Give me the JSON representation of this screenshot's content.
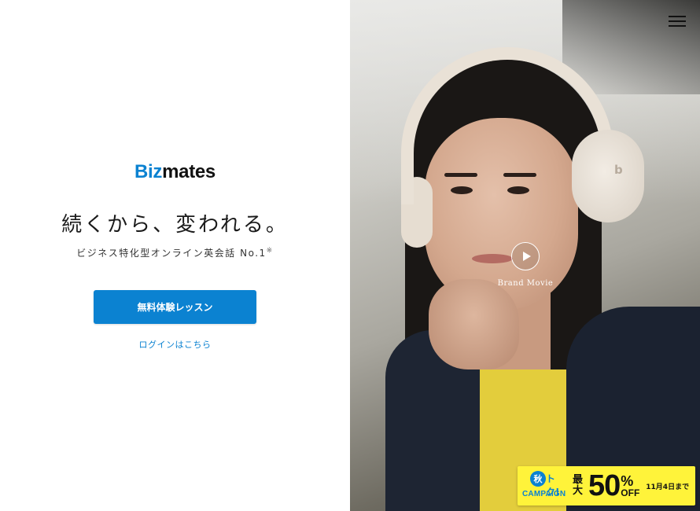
{
  "brand": {
    "logo_prefix": "Biz",
    "logo_suffix": "mates",
    "accent": "#0b82d1"
  },
  "hero": {
    "tagline": "続くから、変われる。",
    "subtagline": "ビジネス特化型オンライン英会話 No.1",
    "subtagline_mark": "※",
    "cta_label": "無料体験レッスン",
    "login_label": "ログインはこちら"
  },
  "media": {
    "movie_label": "Brand Movie",
    "beats_logo": "b"
  },
  "campaign": {
    "badge_kanji": "秋",
    "badge_text": "トク!",
    "badge_word": "CAMPAIGN",
    "max_label": "最大",
    "percent": "50",
    "percent_sign": "%",
    "off_label": "OFF",
    "deadline": "11月4日まで",
    "color": "#fff33a"
  }
}
